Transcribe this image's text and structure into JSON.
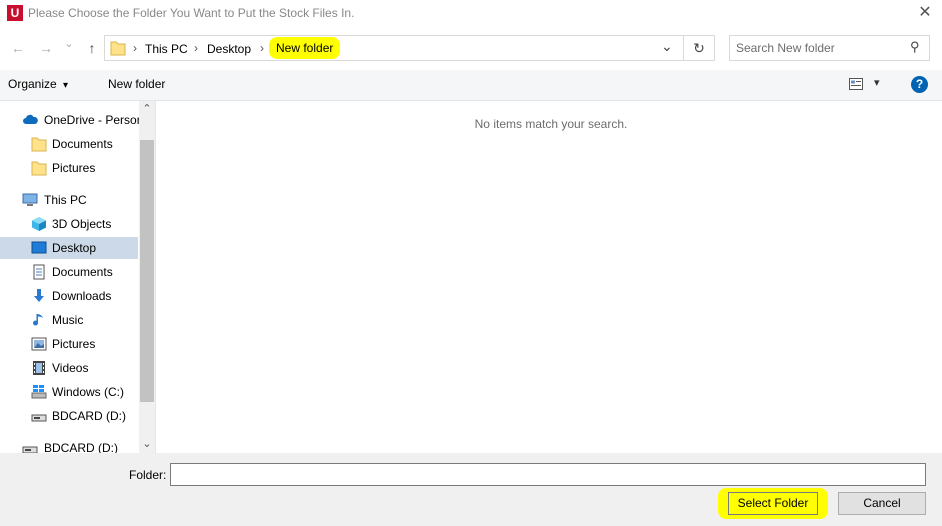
{
  "window": {
    "app_icon_letter": "U",
    "title": "Please Choose the Folder You Want to Put the Stock Files In.",
    "close_glyph": "✕"
  },
  "nav": {
    "back_glyph": "←",
    "forward_glyph": "→",
    "recent_glyph": "⌄",
    "up_glyph": "↑",
    "breadcrumb": [
      "This PC",
      "Desktop",
      "New folder"
    ],
    "breadcrumb_sep": "›",
    "dropdown_glyph": "⌄",
    "refresh_glyph": "↻",
    "search_placeholder": "Search New folder",
    "search_glyph": "⚲"
  },
  "toolbar": {
    "organize_label": "Organize",
    "organize_caret": "▾",
    "new_folder_label": "New folder",
    "view_caret": "▾",
    "help_glyph": "?"
  },
  "sidebar": {
    "items": [
      {
        "label": "OneDrive - Person",
        "icon": "cloud-icon"
      },
      {
        "label": "Documents",
        "icon": "folder-icon"
      },
      {
        "label": "Pictures",
        "icon": "folder-icon"
      },
      {
        "label": "This PC",
        "icon": "computer-icon"
      },
      {
        "label": "3D Objects",
        "icon": "cube-icon"
      },
      {
        "label": "Desktop",
        "icon": "desktop-icon",
        "selected": true
      },
      {
        "label": "Documents",
        "icon": "document-icon"
      },
      {
        "label": "Downloads",
        "icon": "download-arrow-icon"
      },
      {
        "label": "Music",
        "icon": "music-note-icon"
      },
      {
        "label": "Pictures",
        "icon": "picture-icon"
      },
      {
        "label": "Videos",
        "icon": "film-icon"
      },
      {
        "label": "Windows (C:)",
        "icon": "windows-drive-icon"
      },
      {
        "label": "BDCARD (D:)",
        "icon": "drive-icon"
      },
      {
        "label": "BDCARD (D:)",
        "icon": "drive-icon"
      }
    ],
    "scroll_up_glyph": "⌃",
    "scroll_down_glyph": "⌄"
  },
  "content": {
    "empty_message": "No items match your search."
  },
  "footer": {
    "folder_label": "Folder:",
    "folder_value": "",
    "select_button": "Select Folder",
    "cancel_button": "Cancel"
  },
  "colors": {
    "highlight": "#ffff00",
    "selection": "#ccd9e8",
    "app_icon": "#c8102e",
    "help_icon": "#0063b1"
  }
}
